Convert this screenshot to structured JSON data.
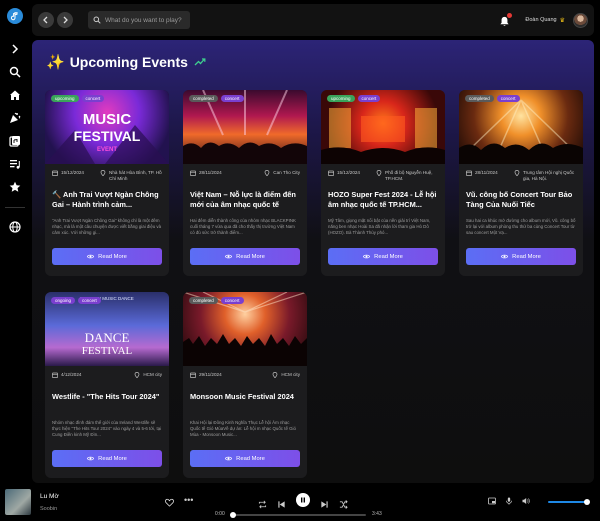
{
  "search": {
    "placeholder": "What do you want to play?"
  },
  "user": {
    "name": "Đoàn Quang",
    "badge": "crown"
  },
  "section": {
    "title": "Upcoming Events",
    "icon": "sparkle-icon",
    "trend_icon": "trending-up-icon"
  },
  "read_more_label": "Read More",
  "colors": {
    "accent_start": "#5b6ef5",
    "accent_end": "#7d4fe8",
    "upcoming_tag": "#3aa35a",
    "completed_tag": "#5a5a5a",
    "category_tag": "#7a3fcf"
  },
  "events": [
    {
      "status": "upcoming",
      "category": "concert",
      "date": "15/12/2024",
      "location": "Nhà hát Hòa Bình, TP. Hồ Chí Minh",
      "title": "Anh Trai Vượt Ngàn Chông Gai – Hành trình cảm...",
      "title_prefix_icon": "hammer-icon",
      "description": "\"Anh Trai Vượt Ngàn Chông Gai\" không chỉ là một đêm nhạc, mà là một câu chuyện được viết bằng giai điệu và cảm xúc. Với những gi...",
      "image_text": [
        "MUSIC",
        "FESTIVAL",
        "EVENT"
      ]
    },
    {
      "status": "completed",
      "category": "concert",
      "date": "28/11/2024",
      "location": "Can Tho City",
      "title": "Việt Nam – Nỗ lực là điểm đến mới của âm nhạc quốc tế",
      "description": "Hai đêm diễn thành công của nhóm nhạc BLACKPINK cuối tháng 7 vừa qua đã cho thấy thị trường Việt Nam có đủ sức trở thành điểm...",
      "image_text": []
    },
    {
      "status": "upcoming",
      "category": "concert",
      "date": "15/12/2024",
      "location": "Phố đi bộ Nguyễn Huệ, TP.HCM.",
      "title": "HOZO Super Fest 2024 - Lễ hội âm nhạc quốc tế TP.HCM...",
      "description": "Mỹ Tâm, giọng mặt nổi bật của nền giải trí Việt Nam, năng ben nhạc Hoài Sa đã nhận lời tham gia Hò Dô (HOZO). Bà Thành Thủy phó...",
      "image_text": []
    },
    {
      "status": "completed",
      "category": "concert",
      "date": "28/11/2024",
      "location": "Trung tâm Hội nghị Quốc gia, Hà Nội.",
      "title": "Vũ. công bố Concert Tour Bảo Tàng Của Nuối Tiếc",
      "description": "Sau hai ca khúc mở đường cho album mới, Vũ. công bố trở lại với album phòng thu thứ ba cùng Concert Tour từ sau concert Một Vạ...",
      "image_text": []
    },
    {
      "status": "ongoing",
      "category": "concert",
      "date": "4/12/2024",
      "location": "HCM city",
      "title": "Westlife - \"The Hits Tour 2024\"",
      "description": "Nhóm nhạc đình đám thế giới của Ireland Westlife sẽ thực hiện \"The Hits Tour 2024\" vào ngày 4 và 5-6 tới, tại Cung Điền kinh Mỹ Đìn...",
      "image_text": [
        "THE NEW MUSIC DANCE",
        "DANCE",
        "FESTIVAL"
      ]
    },
    {
      "status": "completed",
      "category": "concert",
      "date": "29/11/2024",
      "location": "HCM city",
      "title": "Monsoon Music Festival 2024",
      "description": "Khai Hội lại Đông Kinh Nghĩa Thục Lễ hội Âm nhạc Quốc tế Gió MùaVề dự án: Lễ hội m nhạc Quốc tế Gió Mùa - Monsoon Music...",
      "image_text": []
    }
  ],
  "player": {
    "track": "Lu Mờ",
    "artist": "Soobin",
    "time_elapsed": "0:00",
    "time_total": "3:43",
    "progress": 0,
    "volume": 1.0
  }
}
